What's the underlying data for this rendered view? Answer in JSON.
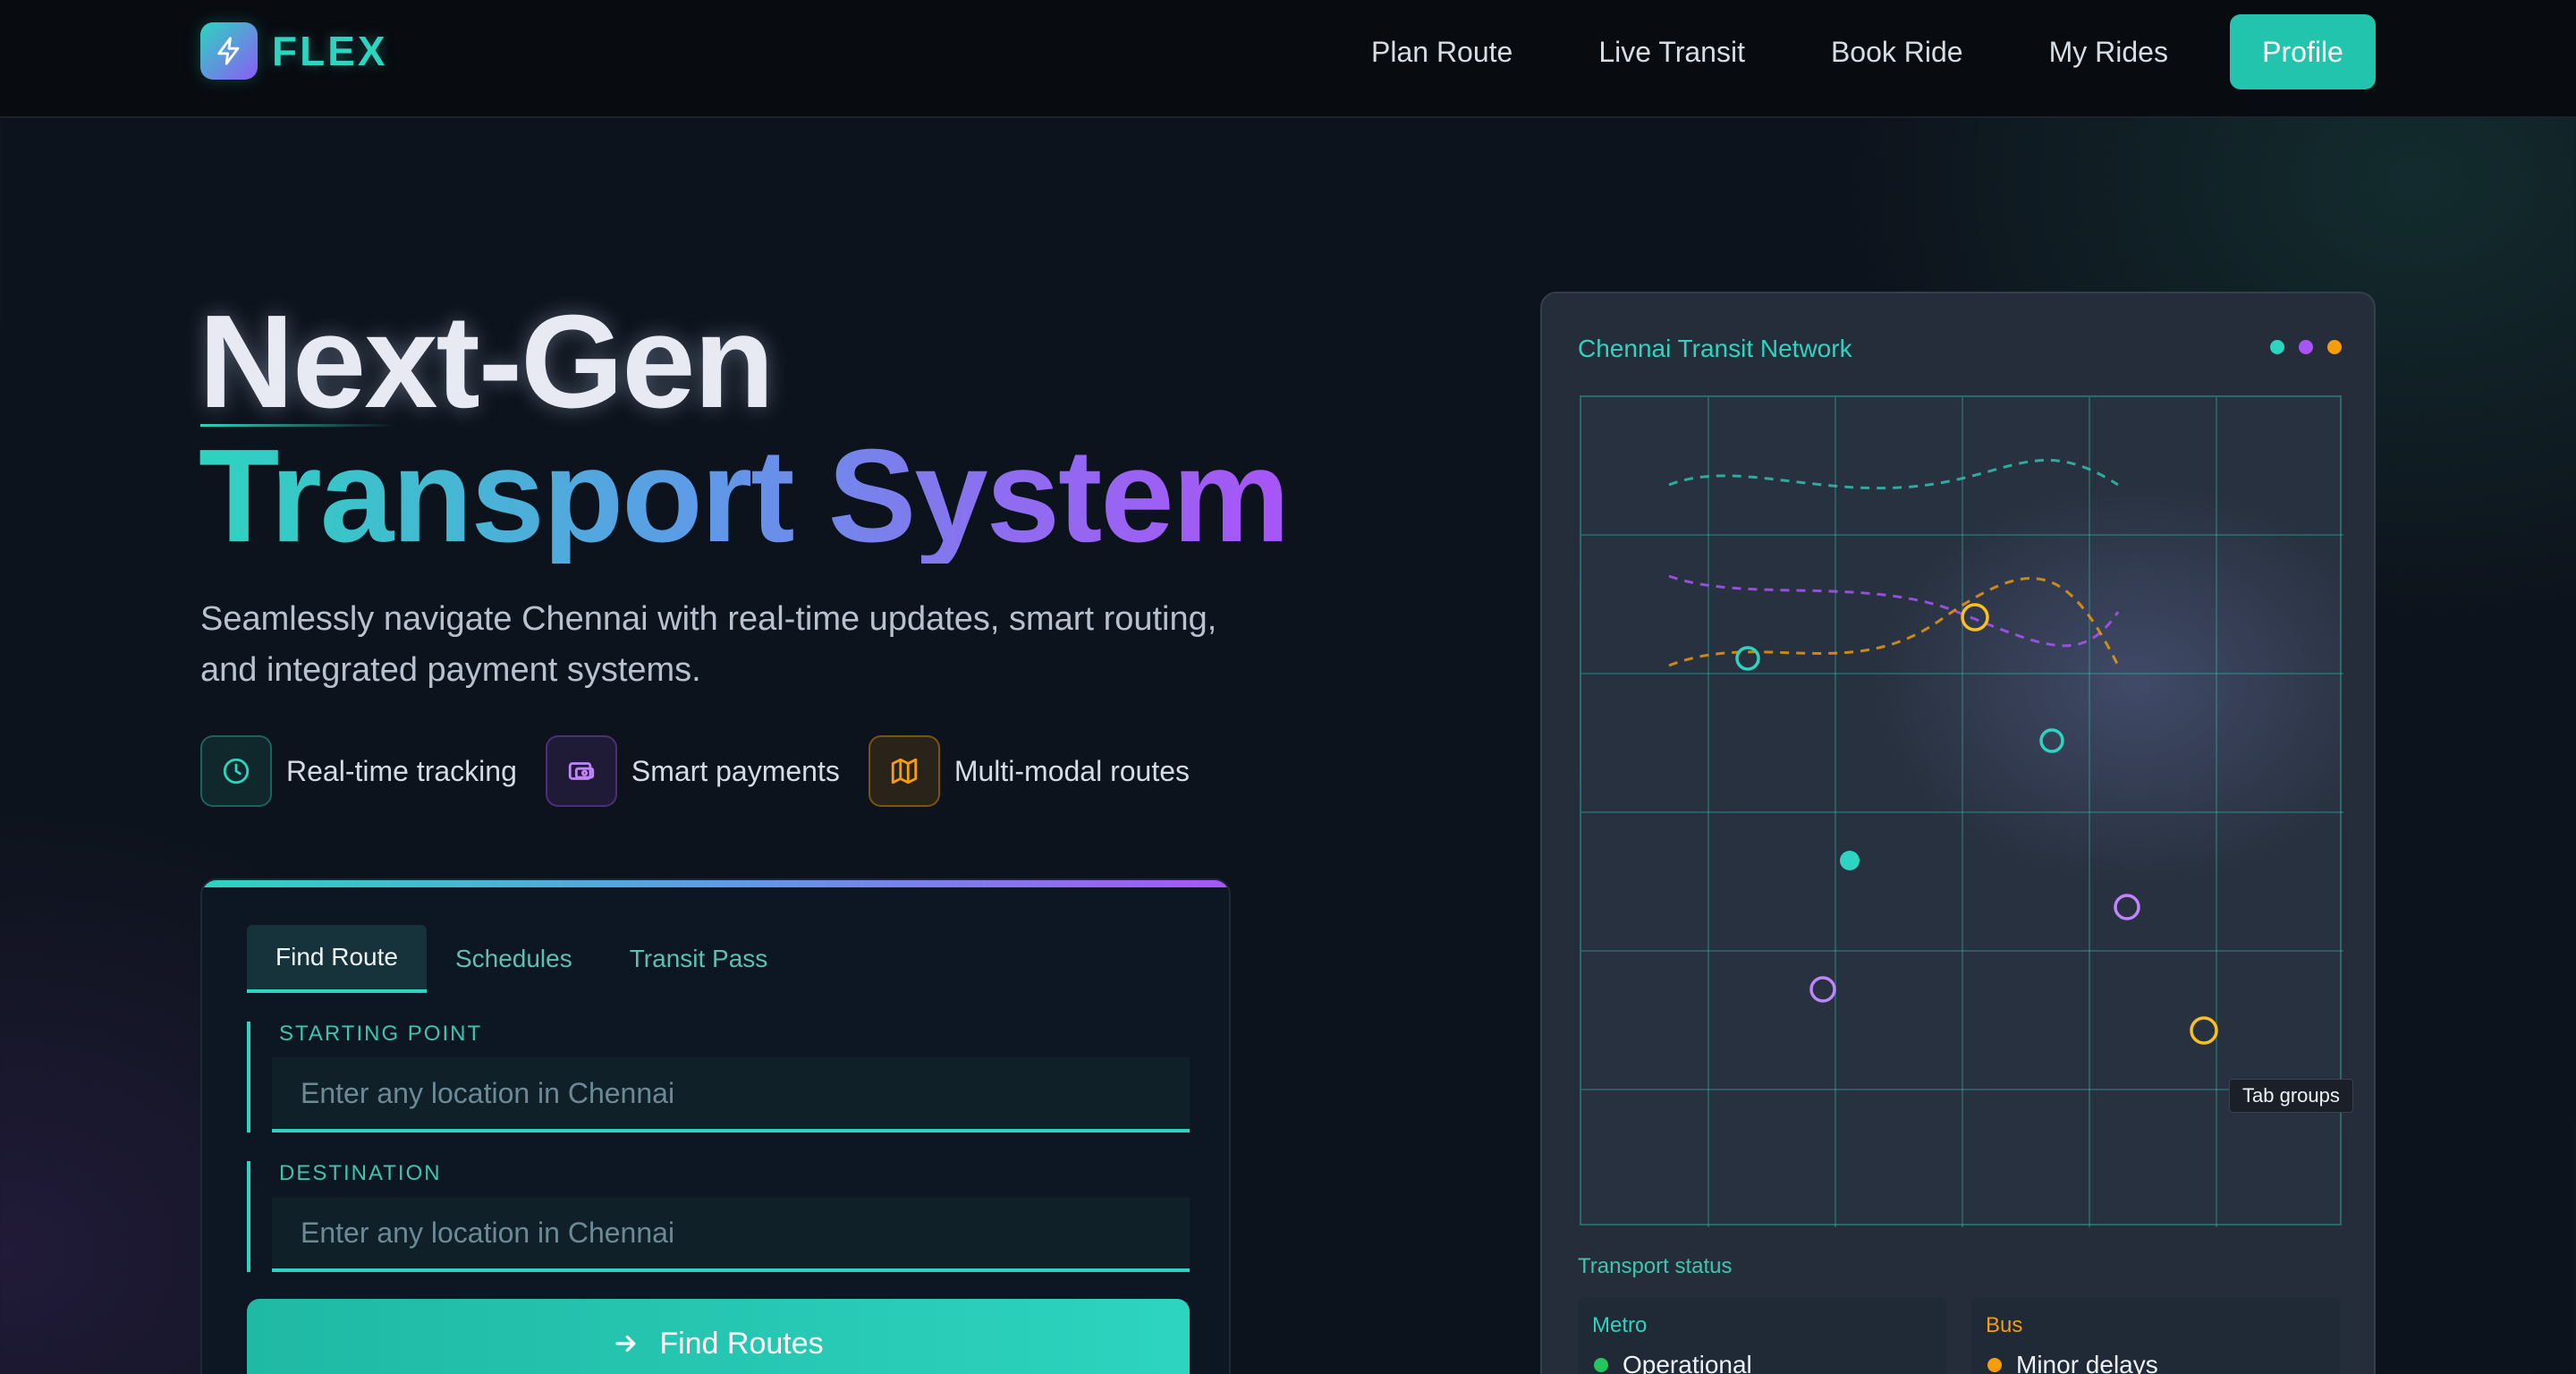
{
  "nav": {
    "brand": "FLEX",
    "links": [
      "Plan Route",
      "Live Transit",
      "Book Ride",
      "My Rides"
    ],
    "profile_label": "Profile"
  },
  "hero": {
    "title_line1": "Next-Gen",
    "title_line2": "Transport System",
    "description": "Seamlessly navigate Chennai with real-time updates, smart routing, and integrated payment systems.",
    "features": [
      {
        "label": "Real-time tracking",
        "icon": "clock-icon"
      },
      {
        "label": "Smart payments",
        "icon": "wallet-icon"
      },
      {
        "label": "Multi-modal routes",
        "icon": "map-icon"
      }
    ]
  },
  "search": {
    "tabs": [
      "Find Route",
      "Schedules",
      "Transit Pass"
    ],
    "active_tab": "Find Route",
    "start_label": "STARTING POINT",
    "start_placeholder": "Enter any location in Chennai",
    "destination_label": "DESTINATION",
    "destination_placeholder": "Enter any location in Chennai",
    "submit_label": "Find Routes"
  },
  "map": {
    "title": "Chennai Transit Network",
    "tooltip": "Tab groups",
    "status_heading": "Transport status",
    "status": [
      {
        "mode": "Metro",
        "state": "Operational",
        "color": "#22c55e"
      },
      {
        "mode": "Bus",
        "state": "Minor delays",
        "color": "#f59e0b"
      }
    ]
  },
  "colors": {
    "teal": "#2dd4bf",
    "purple": "#a855f7",
    "amber": "#f59e0b",
    "background": "#0d131c"
  }
}
